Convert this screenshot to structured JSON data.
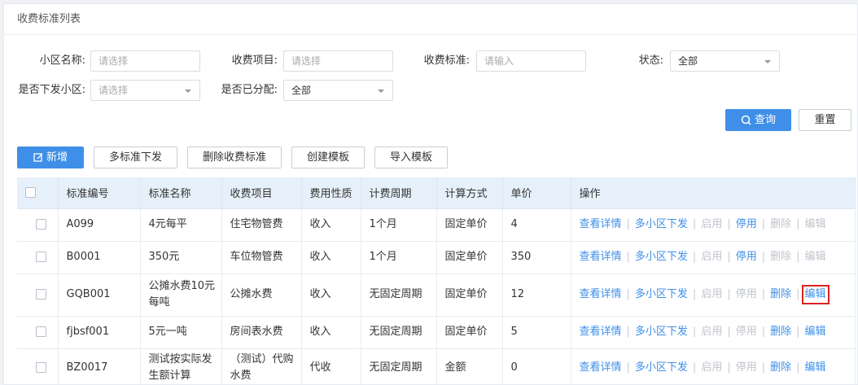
{
  "panel_title": "收费标准列表",
  "filters": {
    "community": {
      "label": "小区名称:",
      "placeholder": "请选择"
    },
    "item": {
      "label": "收费项目:",
      "placeholder": "请选择"
    },
    "standard": {
      "label": "收费标准:",
      "placeholder": "请输入"
    },
    "status": {
      "label": "状态:",
      "value": "全部"
    },
    "dispatched": {
      "label": "是否下发小区:",
      "placeholder": "请选择"
    },
    "allocated": {
      "label": "是否已分配:",
      "value": "全部"
    }
  },
  "buttons": {
    "query": "查询",
    "reset": "重置",
    "add": "新增",
    "multi_dispatch": "多标准下发",
    "delete_standard": "删除收费标准",
    "create_template": "创建模板",
    "import_template": "导入模板"
  },
  "table": {
    "headers": [
      "标准编号",
      "标准名称",
      "收费项目",
      "费用性质",
      "计费周期",
      "计算方式",
      "单价",
      "操作"
    ],
    "rows": [
      {
        "code": "A099",
        "name": "4元每平",
        "item": "住宅物管费",
        "nature": "收入",
        "cycle": "1个月",
        "method": "固定单价",
        "price": "4"
      },
      {
        "code": "B0001",
        "name": "350元",
        "item": "车位物管费",
        "nature": "收入",
        "cycle": "1个月",
        "method": "固定单价",
        "price": "350"
      },
      {
        "code": "GQB001",
        "name": "公摊水费10元每吨",
        "item": "公摊水费",
        "nature": "收入",
        "cycle": "无固定周期",
        "method": "固定单价",
        "price": "12"
      },
      {
        "code": "fjbsf001",
        "name": "5元一吨",
        "item": "房间表水费",
        "nature": "收入",
        "cycle": "无固定周期",
        "method": "固定单价",
        "price": "5"
      },
      {
        "code": "BZ0017",
        "name": "测试按实际发生额计算",
        "item": "（测试）代购水费",
        "nature": "代收",
        "cycle": "无固定周期",
        "method": "金额",
        "price": "0"
      }
    ],
    "ops": {
      "view": "查看详情",
      "dispatch": "多小区下发",
      "enable": "启用",
      "disable": "停用",
      "delete": "删除",
      "edit": "编辑"
    }
  },
  "colors": {
    "primary": "#3f8fe8",
    "header_bg": "#e6f0fa",
    "disabled": "#c0c4cc",
    "highlight": "#e02020"
  }
}
